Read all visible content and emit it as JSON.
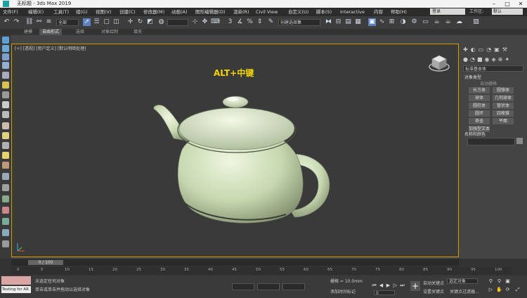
{
  "window": {
    "title": "无标题 - 3ds Max 2019"
  },
  "menu": [
    "文件(F)",
    "编辑(E)",
    "工具(T)",
    "组(G)",
    "视图(V)",
    "创建(C)",
    "修改器(M)",
    "动画(A)",
    "图形编辑器(D)",
    "渲染(R)",
    "Civil View",
    "自定义(U)",
    "脚本(S)",
    "Interactive",
    "内容",
    "帮助(H)"
  ],
  "search": {
    "placeholder": "登录"
  },
  "workspace": {
    "label": "工作区:",
    "value": "默认"
  },
  "toolbar": {
    "filter_value": "全部",
    "selection_set": "创建选择集"
  },
  "ribbon": {
    "tabs": [
      "建模",
      "自由形式",
      "选择",
      "对象绘制",
      "填充"
    ],
    "active": 1
  },
  "viewport": {
    "label": "[+] [透视] [用户定义] [默认明暗处理]",
    "overlay": "ALT+中键"
  },
  "command_panel": {
    "rollout_category": "标准基本体",
    "object_type_title": "对象类型",
    "autogrid": "自动栅格",
    "buttons": [
      "长方体",
      "圆锥体",
      "球体",
      "几何球体",
      "圆柱体",
      "管状体",
      "圆环",
      "四棱锥",
      "茶壶",
      "平面",
      "加强型文本"
    ],
    "name_color_title": "名称和颜色"
  },
  "timeline": {
    "frame_label": "0 / 100",
    "ticks": [
      "0",
      "5",
      "10",
      "15",
      "20",
      "25",
      "30",
      "35",
      "40",
      "45",
      "50",
      "55",
      "60",
      "65",
      "70",
      "75",
      "80",
      "85",
      "90",
      "95",
      "100"
    ]
  },
  "status": {
    "maxscript_label": "Testing for AR",
    "line1": "未选定任何对象",
    "line2": "单击或单击并拖动以选择对象",
    "grid": "栅格 = 10.0mm",
    "addtime": "添加时间标记",
    "autokey": "自动关键点",
    "setkey": "设置关键点",
    "selected_obj": "选定对象",
    "keyfilters": "关键点过滤器...",
    "frame_value": "0"
  }
}
